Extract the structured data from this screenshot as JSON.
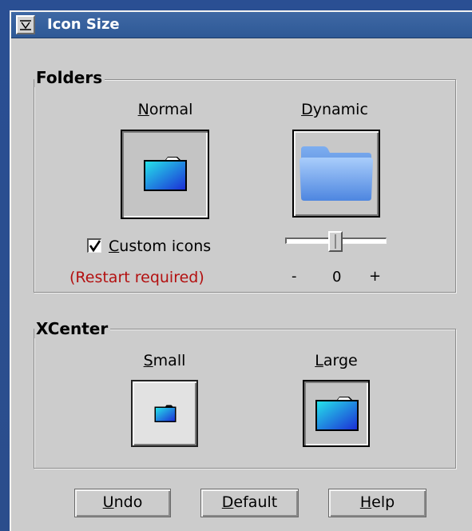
{
  "window": {
    "title": "Icon Size"
  },
  "folders": {
    "label": "Folders",
    "normal": {
      "label_ul": "N",
      "label_rest": "ormal"
    },
    "dynamic": {
      "label_ul": "D",
      "label_rest": "ynamic"
    },
    "custom_icons": {
      "checked": true,
      "label_ul": "C",
      "label_rest": "ustom icons"
    },
    "restart_note": "(Restart required)",
    "slider": {
      "value": 0.5,
      "tick_minus": "-",
      "tick_zero": "0",
      "tick_plus": "+"
    }
  },
  "xcenter": {
    "label": "XCenter",
    "small": {
      "label_ul": "S",
      "label_rest": "mall"
    },
    "large": {
      "label_ul": "L",
      "label_rest": "arge"
    }
  },
  "buttons": {
    "undo": {
      "label_ul": "U",
      "label_rest": "ndo"
    },
    "default": {
      "label_ul": "D",
      "label_rest": "efault"
    },
    "help": {
      "label_ul": "H",
      "label_rest": "elp"
    }
  },
  "icons": {
    "system_menu": "chevron-down-icon",
    "folder_normal": "folder-icon",
    "folder_dynamic": "folder-icon",
    "folder_small": "folder-icon",
    "folder_large": "folder-icon"
  },
  "colors": {
    "desktop": "#2a4f93",
    "titlebar": "#3a64a0",
    "dialog": "#cccccc",
    "restart_text": "#b31010"
  }
}
